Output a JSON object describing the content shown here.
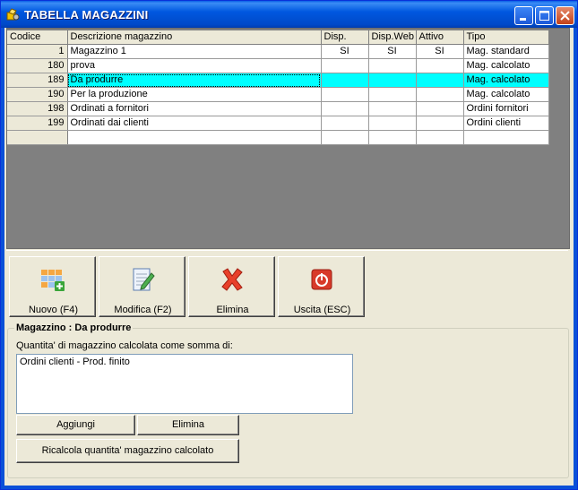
{
  "window": {
    "title": "TABELLA MAGAZZINI"
  },
  "grid": {
    "columns": [
      "Codice",
      "Descrizione magazzino",
      "Disp.",
      "Disp.Web",
      "Attivo",
      "Tipo"
    ],
    "rows": [
      {
        "codice": "1",
        "descrizione": "Magazzino 1",
        "disp": "SI",
        "disp_web": "SI",
        "attivo": "SI",
        "tipo": "Mag. standard"
      },
      {
        "codice": "180",
        "descrizione": "prova",
        "disp": "",
        "disp_web": "",
        "attivo": "",
        "tipo": "Mag. calcolato"
      },
      {
        "codice": "189",
        "descrizione": "Da produrre",
        "disp": "",
        "disp_web": "",
        "attivo": "",
        "tipo": "Mag. calcolato"
      },
      {
        "codice": "190",
        "descrizione": "Per la produzione",
        "disp": "",
        "disp_web": "",
        "attivo": "",
        "tipo": "Mag. calcolato"
      },
      {
        "codice": "198",
        "descrizione": "Ordinati a fornitori",
        "disp": "",
        "disp_web": "",
        "attivo": "",
        "tipo": "Ordini fornitori"
      },
      {
        "codice": "199",
        "descrizione": "Ordinati dai clienti",
        "disp": "",
        "disp_web": "",
        "attivo": "",
        "tipo": "Ordini clienti"
      },
      {
        "codice": "",
        "descrizione": "",
        "disp": "",
        "disp_web": "",
        "attivo": "",
        "tipo": ""
      }
    ],
    "selected_row_index": 2,
    "highlight_color": "#00ffff"
  },
  "toolbar": {
    "new_label": "Nuovo (F4)",
    "edit_label": "Modifica (F2)",
    "delete_label": "Elimina",
    "exit_label": "Uscita (ESC)",
    "new_icon": "grid-add-icon",
    "edit_icon": "notepad-pencil-icon",
    "delete_icon": "red-x-icon",
    "exit_icon": "power-icon"
  },
  "detail": {
    "group_title": "Magazzino : Da produrre",
    "sum_label": "Quantita' di magazzino calcolata come somma di:",
    "list_items": [
      "Ordini clienti - Prod. finito"
    ],
    "add_label": "Aggiungi",
    "remove_label": "Elimina",
    "recalc_label": "Ricalcola quantita' magazzino calcolato"
  },
  "colors": {
    "titlebar": "#0058e0",
    "window_bg": "#ece9d8",
    "grid_bg": "#808080"
  }
}
